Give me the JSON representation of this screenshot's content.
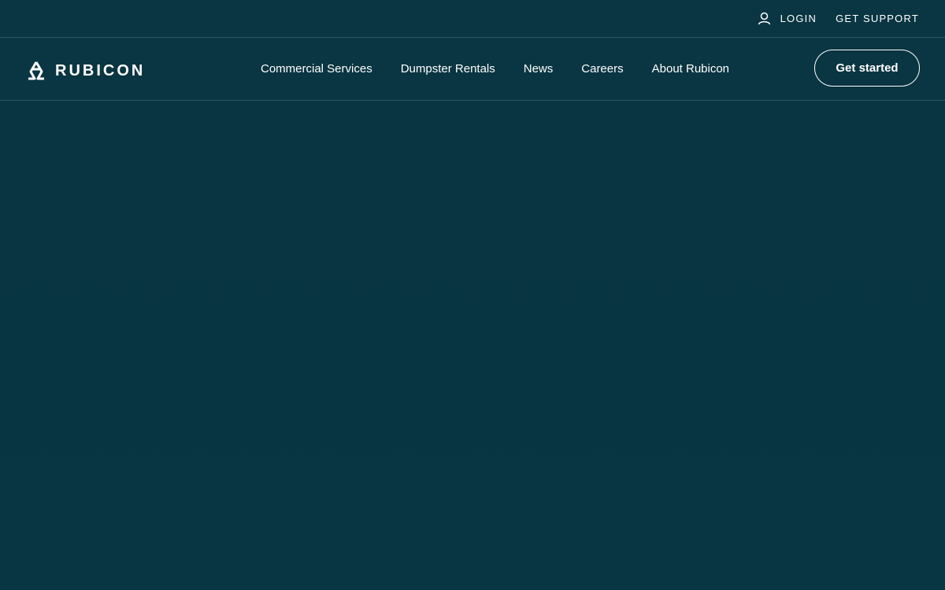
{
  "utility": {
    "login_label": "LOGIN",
    "support_label": "GET SUPPORT",
    "login_icon": "user-icon"
  },
  "brand": {
    "name": "RUBICON",
    "logo_icon": "rubicon-logo-mark"
  },
  "nav": {
    "items": [
      {
        "label": "Commercial Services"
      },
      {
        "label": "Dumpster Rentals"
      },
      {
        "label": "News"
      },
      {
        "label": "Careers"
      },
      {
        "label": "About Rubicon"
      }
    ]
  },
  "cta": {
    "label": "Get started"
  },
  "colors": {
    "background": "#083542",
    "border": "#2c5863",
    "text": "#ffffff"
  }
}
